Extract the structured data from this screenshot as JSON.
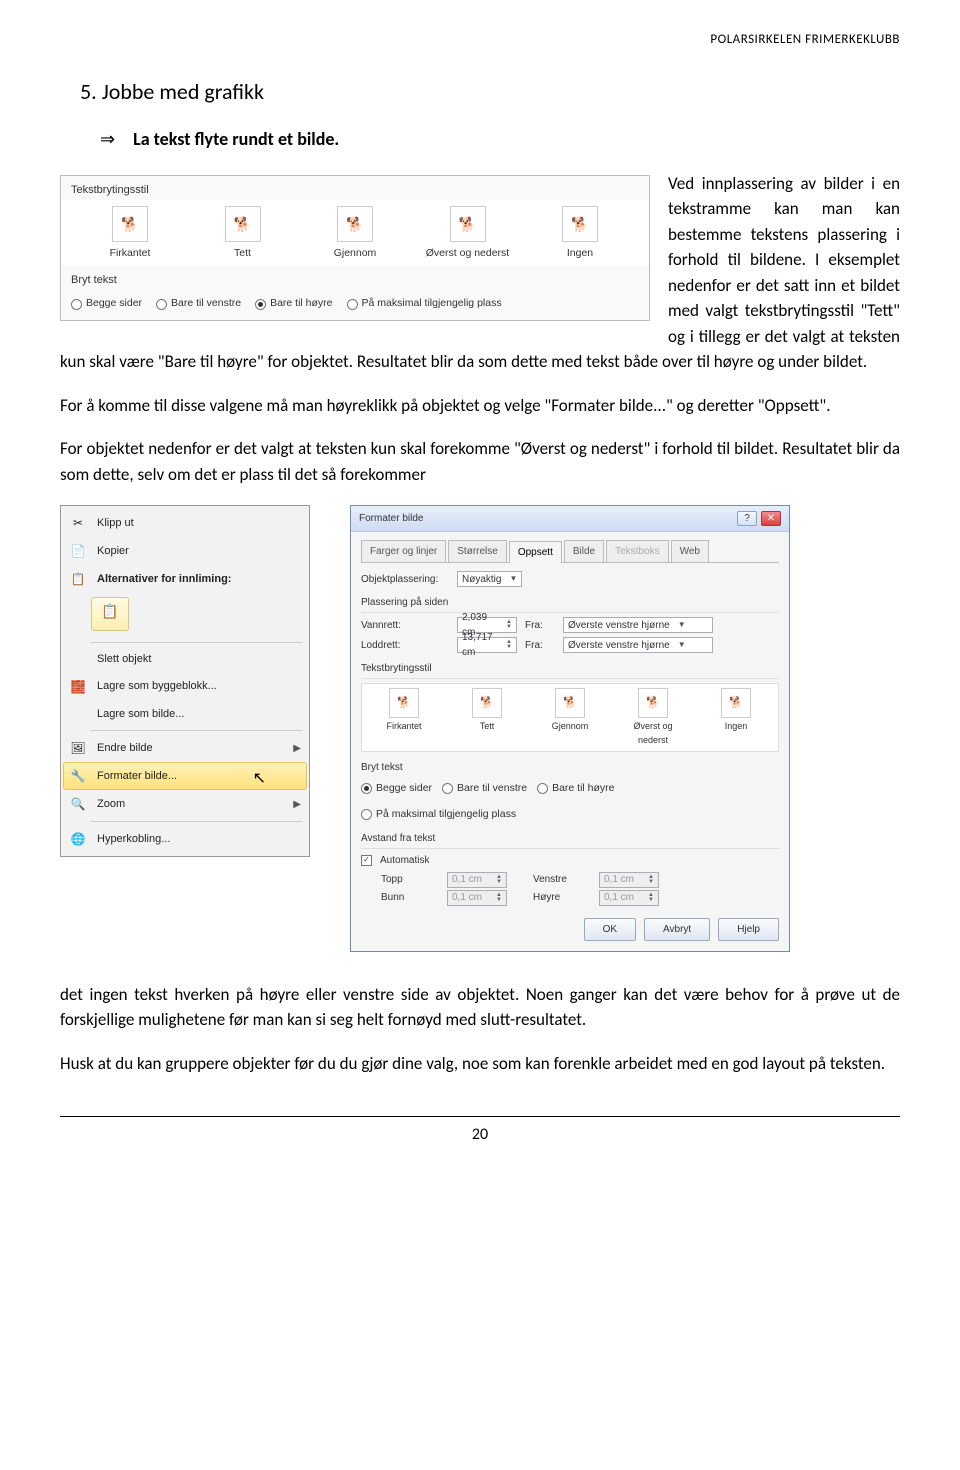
{
  "header": "POLARSIRKELEN FRIMERKEKLUBB",
  "section_num": "5.",
  "section_title": "Jobbe med grafikk",
  "arrow_symbol": "⇒",
  "arrow_text": "La tekst flyte rundt et bilde.",
  "para1": "Ved innplassering av bilder i en tekstramme kan man kan bestemme tekstens plassering i forhold til bildene. I eksemplet nedenfor er det satt inn et bildet med valgt tekstbrytingsstil \"Tett\" og i tillegg er det valgt at teksten kun skal være \"Bare til høyre\" for objektet. Resultatet blir da som dette med tekst både over til høyre og under bildet.",
  "para2": "For å komme til disse valgene må man høyreklikk  på objektet og velge \"Formater bilde...\" og deretter \"Oppsett\".",
  "para3": "For objektet nedenfor er det valgt at teksten kun skal forekomme \"Øverst og nederst\" i forhold til bildet. Resultatet blir da som dette, selv om det er plass til det så forekommer",
  "para4": "det  ingen tekst hverken på høyre eller venstre side av objektet. Noen ganger kan det være behov for å prøve ut de forskjellige mulighetene før man kan si seg helt fornøyd med slutt-resultatet.",
  "para5": "Husk at du kan gruppere objekter før du du gjør dine valg, noe som kan forenkle arbeidet med en god layout på teksten.",
  "page_num": "20",
  "wrap_panel": {
    "title": "Tekstbrytingsstil",
    "styles": [
      "Firkantet",
      "Tett",
      "Gjennom",
      "Øverst og nederst",
      "Ingen"
    ],
    "break_title": "Bryt tekst",
    "options": [
      "Begge sider",
      "Bare til venstre",
      "Bare til høyre",
      "På maksimal tilgjengelig plass"
    ],
    "selected": 2
  },
  "context_menu": {
    "items": [
      {
        "icon": "✂",
        "label": "Klipp ut",
        "u": "K"
      },
      {
        "icon": "📄",
        "label": "Kopier",
        "u": "K"
      },
      {
        "icon": "📋",
        "label": "Alternativer for innliming:",
        "bold": true
      },
      {
        "sep": true
      },
      {
        "icon": "",
        "label": "Slett objekt"
      },
      {
        "icon": "🧱",
        "label": "Lagre som byggeblokk...",
        "u": "L"
      },
      {
        "icon": "",
        "label": "Lagre som bilde...",
        "u": "L"
      },
      {
        "sep": true
      },
      {
        "icon": "🖼",
        "label": "Endre bilde",
        "u": "E",
        "arrow": true
      },
      {
        "icon": "🔧",
        "label": "Formater bilde...",
        "u": "F",
        "highlight": true,
        "cursor": true
      },
      {
        "icon": "🔍",
        "label": "Zoom",
        "u": "Z",
        "arrow": true
      },
      {
        "sep": true
      },
      {
        "icon": "🌐",
        "label": "Hyperkobling...",
        "u": "H"
      }
    ]
  },
  "dialog": {
    "title": "Formater bilde",
    "tabs": [
      "Farger og linjer",
      "Størrelse",
      "Oppsett",
      "Bilde",
      "Tekstboks",
      "Web"
    ],
    "active_tab": 2,
    "obj_label": "Objektplassering:",
    "obj_value": "Nøyaktig",
    "page_group": "Plassering på siden",
    "hor_label": "Vannrett:",
    "hor_value": "2,039 cm",
    "ver_label": "Loddrett:",
    "ver_value": "13,717 cm",
    "from_label": "Fra:",
    "from_value": "Øverste venstre hjørne",
    "wrap_group": "Tekstbrytingsstil",
    "wrap_styles": [
      "Firkantet",
      "Tett",
      "Gjennom",
      "Øverst og nederst",
      "Ingen"
    ],
    "break_group": "Bryt tekst",
    "break_options": [
      "Begge sider",
      "Bare til venstre",
      "Bare til høyre",
      "På maksimal tilgjengelig plass"
    ],
    "break_selected": 0,
    "dist_group": "Avstand fra tekst",
    "auto_label": "Automatisk",
    "dist_rows": [
      {
        "l1": "Topp",
        "v1": "0,1 cm",
        "l2": "Venstre",
        "v2": "0,1 cm"
      },
      {
        "l1": "Bunn",
        "v1": "0,1 cm",
        "l2": "Høyre",
        "v2": "0,1 cm"
      }
    ],
    "buttons": [
      "OK",
      "Avbryt",
      "Hjelp"
    ]
  }
}
